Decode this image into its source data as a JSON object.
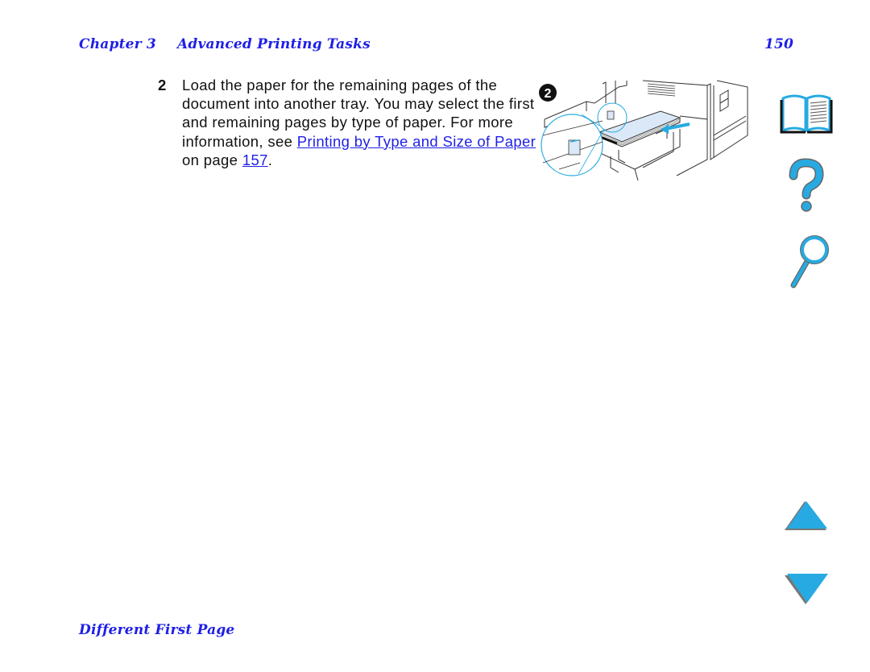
{
  "header": {
    "chapter": "Chapter 3",
    "title": "Advanced Printing Tasks",
    "page_number": "150"
  },
  "step": {
    "number": "2",
    "text_before_link": "Load the paper for the remaining pages of the document into another tray. You may select the first and remaining pages by type of paper. For more information, see ",
    "link_text": "Printing by Type and Size of Paper",
    "text_middle": " on page ",
    "page_link": "157",
    "text_end": "."
  },
  "illustration": {
    "callout_number": "2",
    "description": "Paper stack being loaded into an open printer tray with magnified guide detail"
  },
  "navigation": {
    "contents_icon": "book-icon",
    "help_icon": "question-mark-icon",
    "search_icon": "magnifier-icon",
    "previous_icon": "triangle-up-icon",
    "next_icon": "triangle-down-icon",
    "accent_color": "#27aae1"
  },
  "footer": {
    "section_title": "Different First Page"
  }
}
